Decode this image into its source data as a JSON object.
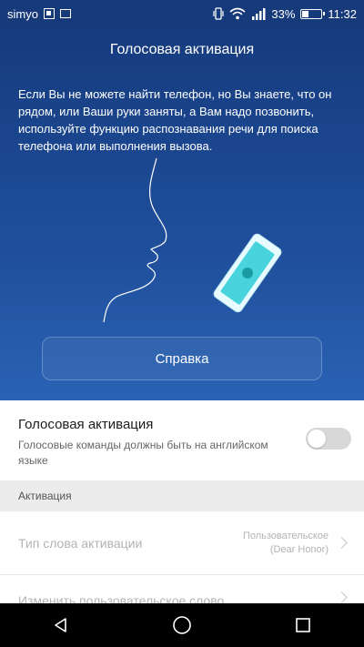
{
  "status_bar": {
    "carrier": "simyo",
    "battery_percent": "33%",
    "battery_level": 0.33,
    "time": "11:32"
  },
  "hero": {
    "title": "Голосовая активация",
    "description": "Если Вы не можете найти телефон, но Вы знаете, что он рядом, или Ваши руки заняты, а Вам надо позвонить, используйте функцию распознавания речи для поиска телефона или выполнения вызова.",
    "help_button_label": "Справка"
  },
  "voice_activation": {
    "title": "Голосовая активация",
    "description": "Голосовые команды должны быть на английском языке",
    "enabled": false
  },
  "activation_section": {
    "header": "Активация",
    "items": [
      {
        "label": "Тип слова активации",
        "value": "Пользовательское",
        "value_sub": "(Dear Honor)"
      },
      {
        "label": "Изменить пользовательское слово",
        "value": "",
        "value_sub": ""
      }
    ]
  },
  "nav_bar": {
    "icons": [
      "back-icon",
      "home-icon",
      "recents-icon"
    ]
  }
}
